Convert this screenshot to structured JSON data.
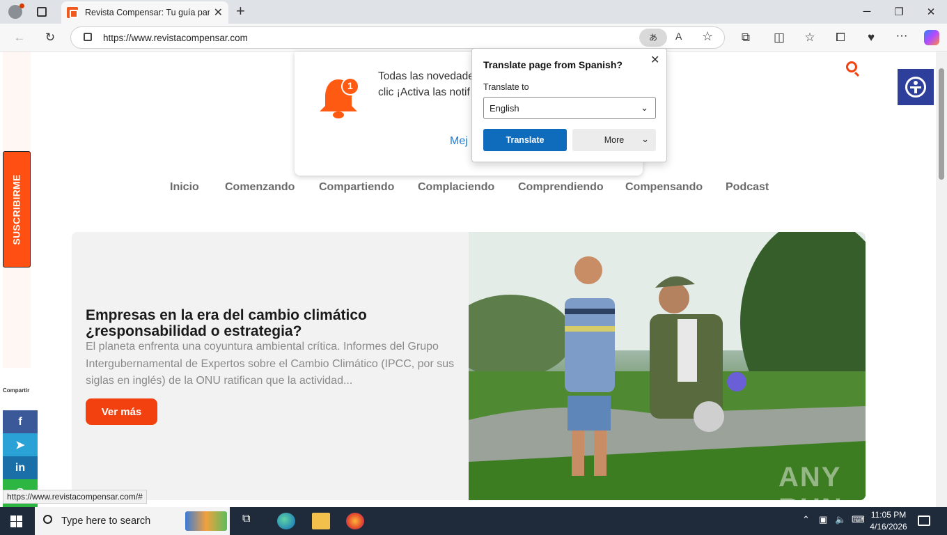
{
  "browser": {
    "tab_title": "Revista Compensar: Tu guía para a",
    "url": "https://www.revistacompensar.com",
    "status_url": "https://www.revistacompensar.com/#"
  },
  "translate_popup": {
    "title": "Translate page from Spanish?",
    "label": "Translate to",
    "language": "English",
    "translate_label": "Translate",
    "more_label": "More"
  },
  "notification": {
    "badge": "1",
    "line1": "Todas las novedade",
    "line2": "clic ¡Activa las notif",
    "action": "Mej"
  },
  "sidebar": {
    "subscribe_label": "SUSCRIBIRME",
    "share_label": "Compartir"
  },
  "nav": {
    "items": [
      "Inicio",
      "Comenzando",
      "Compartiendo",
      "Complaciendo",
      "Comprendiendo",
      "Compensando",
      "Podcast"
    ]
  },
  "hero": {
    "title": "Empresas en la era del cambio climático ¿responsabilidad o estrategia?",
    "text": "El planeta enfrenta una coyuntura ambiental crítica. Informes del Grupo Intergubernamental de Expertos sobre el Cambio Climático (IPCC, por sus siglas en inglés) de la ONU ratifican que la actividad...",
    "button": "Ver más"
  },
  "watermark": "ANY RUN",
  "taskbar": {
    "search_placeholder": "Type here to search",
    "time": "11:05 PM",
    "date": "4/16/2026"
  },
  "colors": {
    "brand": "#f2410f",
    "edge_blue": "#0f6cbd",
    "a11y": "#2e3f9b"
  }
}
